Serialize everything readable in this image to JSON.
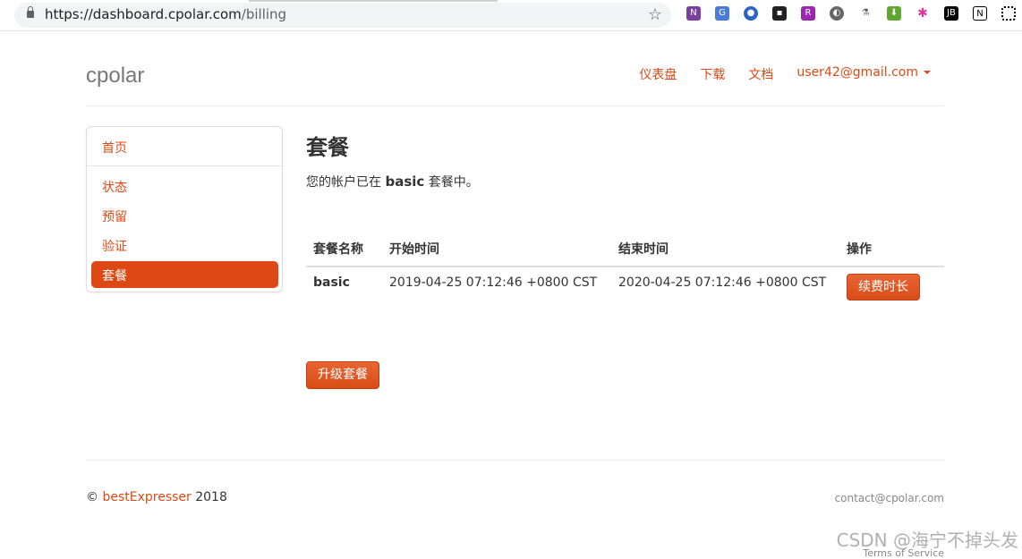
{
  "browser": {
    "url_host": "https://dashboard.cpolar.com",
    "url_path": "/billing"
  },
  "site": {
    "brand": "cpolar",
    "nav": [
      "仪表盘",
      "下载",
      "文档"
    ],
    "user": "user42@gmail.com"
  },
  "sidebar": {
    "items": [
      "首页",
      "状态",
      "预留",
      "验证",
      "套餐"
    ],
    "active": "套餐"
  },
  "main": {
    "title": "套餐",
    "desc_prefix": "您的帐户已在",
    "desc_plan": "basic",
    "desc_suffix": "套餐中。",
    "columns": [
      "套餐名称",
      "开始时间",
      "结束时间",
      "操作"
    ],
    "rows": [
      {
        "name": "basic",
        "start": "2019-04-25 07:12:46 +0800 CST",
        "end": "2020-04-25 07:12:46 +0800 CST",
        "action": "续费时长"
      }
    ],
    "upgrade_button": "升级套餐"
  },
  "footer": {
    "copyright_symbol": "©",
    "author": "bestExpresser",
    "year": "2018",
    "contact": "contact@cpolar.com",
    "tos": "Terms of Service"
  },
  "watermark": "CSDN @海宁不掉头发",
  "extension_icons": [
    "onenote-icon",
    "translate-icon",
    "extension-icon",
    "extension-icon",
    "extension-icon",
    "extension-icon",
    "extension-icon",
    "extension-icon",
    "extension-icon",
    "jetbrains-icon",
    "notion-icon",
    "qr-code-icon"
  ]
}
